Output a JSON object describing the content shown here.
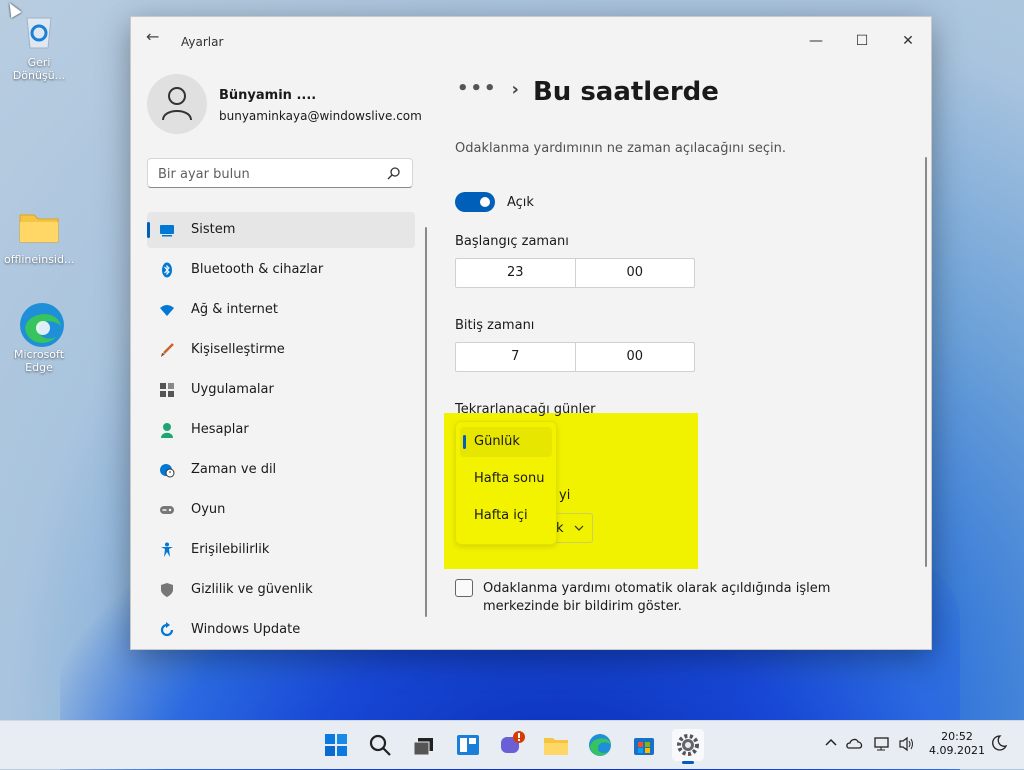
{
  "desktop": {
    "icons": [
      {
        "label": "Geri Dönüşü..."
      },
      {
        "label": "offlineinsid..."
      },
      {
        "label": "Microsoft Edge"
      }
    ]
  },
  "window": {
    "app_title": "Ayarlar",
    "back_glyph": "←",
    "min_glyph": "—",
    "max_glyph": "☐",
    "close_glyph": "✕"
  },
  "profile": {
    "name": "Bünyamin ....",
    "email": "bunyaminkaya@windowslive.com"
  },
  "search": {
    "placeholder": "Bir ayar bulun"
  },
  "nav": {
    "items": [
      {
        "label": "Sistem",
        "icon": "monitor-icon",
        "color": "#0078d4"
      },
      {
        "label": "Bluetooth & cihazlar",
        "icon": "bluetooth-icon",
        "color": "#0078d4"
      },
      {
        "label": "Ağ & internet",
        "icon": "wifi-icon",
        "color": "#0078d4"
      },
      {
        "label": "Kişiselleştirme",
        "icon": "brush-icon",
        "color": "#c9632b"
      },
      {
        "label": "Uygulamalar",
        "icon": "apps-icon",
        "color": "#555555"
      },
      {
        "label": "Hesaplar",
        "icon": "person-icon",
        "color": "#1ea672"
      },
      {
        "label": "Zaman ve dil",
        "icon": "globe-clock-icon",
        "color": "#0078d4"
      },
      {
        "label": "Oyun",
        "icon": "gamepad-icon",
        "color": "#666666"
      },
      {
        "label": "Erişilebilirlik",
        "icon": "accessibility-icon",
        "color": "#0078d4"
      },
      {
        "label": "Gizlilik ve güvenlik",
        "icon": "shield-icon",
        "color": "#666666"
      },
      {
        "label": "Windows Update",
        "icon": "update-icon",
        "color": "#0078d4"
      }
    ]
  },
  "content": {
    "breadcrumb_dots": "•••",
    "breadcrumb_chevron": "›",
    "page_title": "Bu saatlerde",
    "description": "Odaklanma yardımının ne zaman açılacağını seçin.",
    "toggle_label": "Açık",
    "start_label": "Başlangıç zamanı",
    "start_hour": "23",
    "start_minute": "00",
    "end_label": "Bitiş zamanı",
    "end_hour": "7",
    "end_minute": "00",
    "repeat_label": "Tekrarlanacağı günler",
    "repeat_options": [
      {
        "label": "Günlük",
        "selected": true
      },
      {
        "label": "Hafta sonu",
        "selected": false
      },
      {
        "label": "Hafta içi",
        "selected": false
      }
    ],
    "hidden_text_fragment": "yi",
    "hidden_select_fragment": "k",
    "checkbox_text": "Odaklanma yardımı otomatik olarak açıldığında işlem merkezinde bir bildirim göster."
  },
  "taskbar": {
    "time": "20:52",
    "date": "4.09.2021",
    "accent": "#005fb8"
  }
}
